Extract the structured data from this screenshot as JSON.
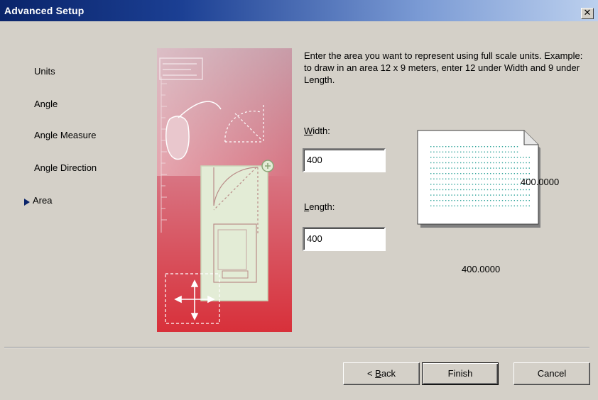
{
  "window": {
    "title": "Advanced Setup",
    "close_glyph": "✕"
  },
  "steps": [
    {
      "label": "Units"
    },
    {
      "label": "Angle"
    },
    {
      "label": "Angle Measure"
    },
    {
      "label": "Angle Direction"
    },
    {
      "label": "Area",
      "current": true
    }
  ],
  "description": "Enter the area you want to represent using full scale units.  Example: to draw in an area 12 x 9 meters, enter 12 under Width and 9 under Length.",
  "width": {
    "mnemonic": "W",
    "label_rest": "idth:",
    "value": "400"
  },
  "length": {
    "mnemonic": "L",
    "label_rest": "ength:",
    "value": "400"
  },
  "preview": {
    "horizontal_dimension": "400.0000",
    "vertical_dimension": "400.0000"
  },
  "buttons": {
    "back_prefix": "< ",
    "back_mnemonic": "B",
    "back_rest": "ack",
    "finish": "Finish",
    "cancel": "Cancel"
  },
  "colors": {
    "titlebar_start": "#0a246a",
    "titlebar_end": "#bcd0ee",
    "dialog_bg": "#d4d0c8",
    "illustration_red": "#d8303a",
    "illustration_paper": "#e3ecd6",
    "grid_dots": "#2fa39a"
  }
}
